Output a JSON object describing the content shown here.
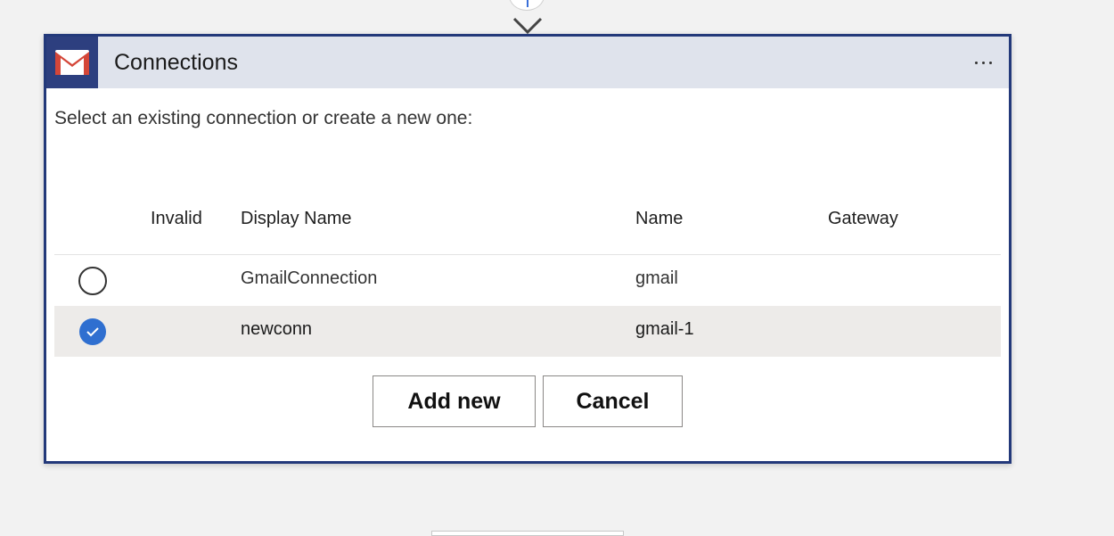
{
  "card": {
    "title": "Connections",
    "icon": "gmail-icon",
    "more_icon": "more-icon"
  },
  "instruction": "Select an existing connection or create a new one:",
  "table": {
    "columns": [
      "Invalid",
      "Display Name",
      "Name",
      "Gateway"
    ],
    "rows": [
      {
        "display_name": "GmailConnection",
        "name": "gmail",
        "gateway": "",
        "selected": false
      },
      {
        "display_name": "newconn",
        "name": "gmail-1",
        "gateway": "",
        "selected": true
      }
    ]
  },
  "buttons": {
    "add_new": "Add new",
    "cancel": "Cancel"
  },
  "colors": {
    "accent_border": "#23397a",
    "header_bg": "#dfe3ec",
    "logo_bg": "#2d3f7f",
    "radio_checked": "#2f6fd0",
    "selected_row_bg": "#edebe9"
  }
}
